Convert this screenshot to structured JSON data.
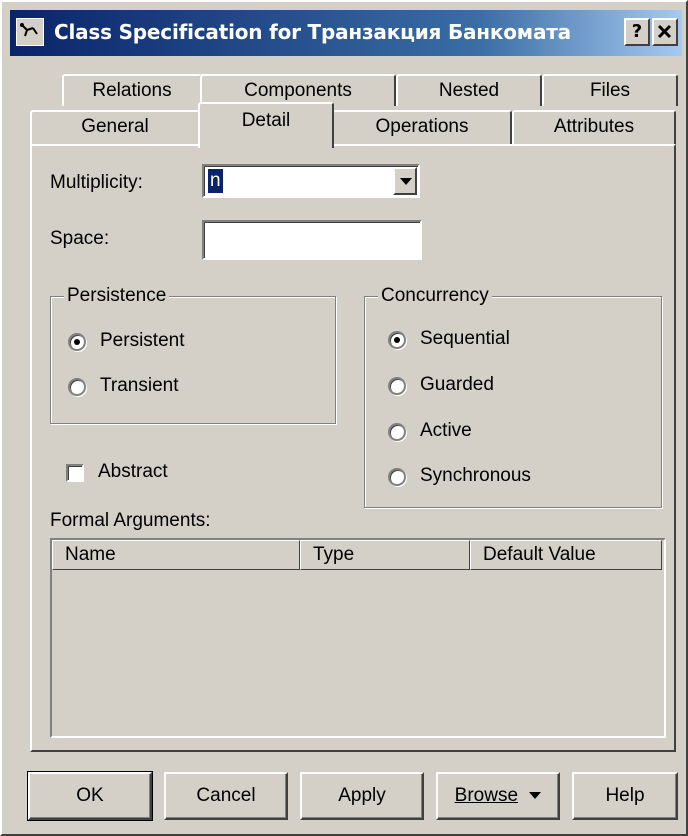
{
  "window": {
    "title": "Class Specification for Транзакция Банкомата",
    "help_button": "?",
    "close_button": "✕"
  },
  "tabs": {
    "row1": [
      "Relations",
      "Components",
      "Nested",
      "Files"
    ],
    "row2": [
      "General",
      "Detail",
      "Operations",
      "Attributes"
    ],
    "active": "Detail"
  },
  "detail": {
    "multiplicity_label": "Multiplicity:",
    "multiplicity_value": "n",
    "space_label": "Space:",
    "space_value": "",
    "persistence": {
      "title": "Persistence",
      "options": [
        "Persistent",
        "Transient"
      ],
      "selected": "Persistent"
    },
    "concurrency": {
      "title": "Concurrency",
      "options": [
        "Sequential",
        "Guarded",
        "Active",
        "Synchronous"
      ],
      "selected": "Sequential"
    },
    "abstract_label": "Abstract",
    "abstract_checked": false,
    "formal_arguments_label": "Formal Arguments:",
    "columns": [
      "Name",
      "Type",
      "Default Value"
    ]
  },
  "buttons": {
    "ok": "OK",
    "cancel": "Cancel",
    "apply": "Apply",
    "browse": "Browse",
    "help": "Help"
  }
}
